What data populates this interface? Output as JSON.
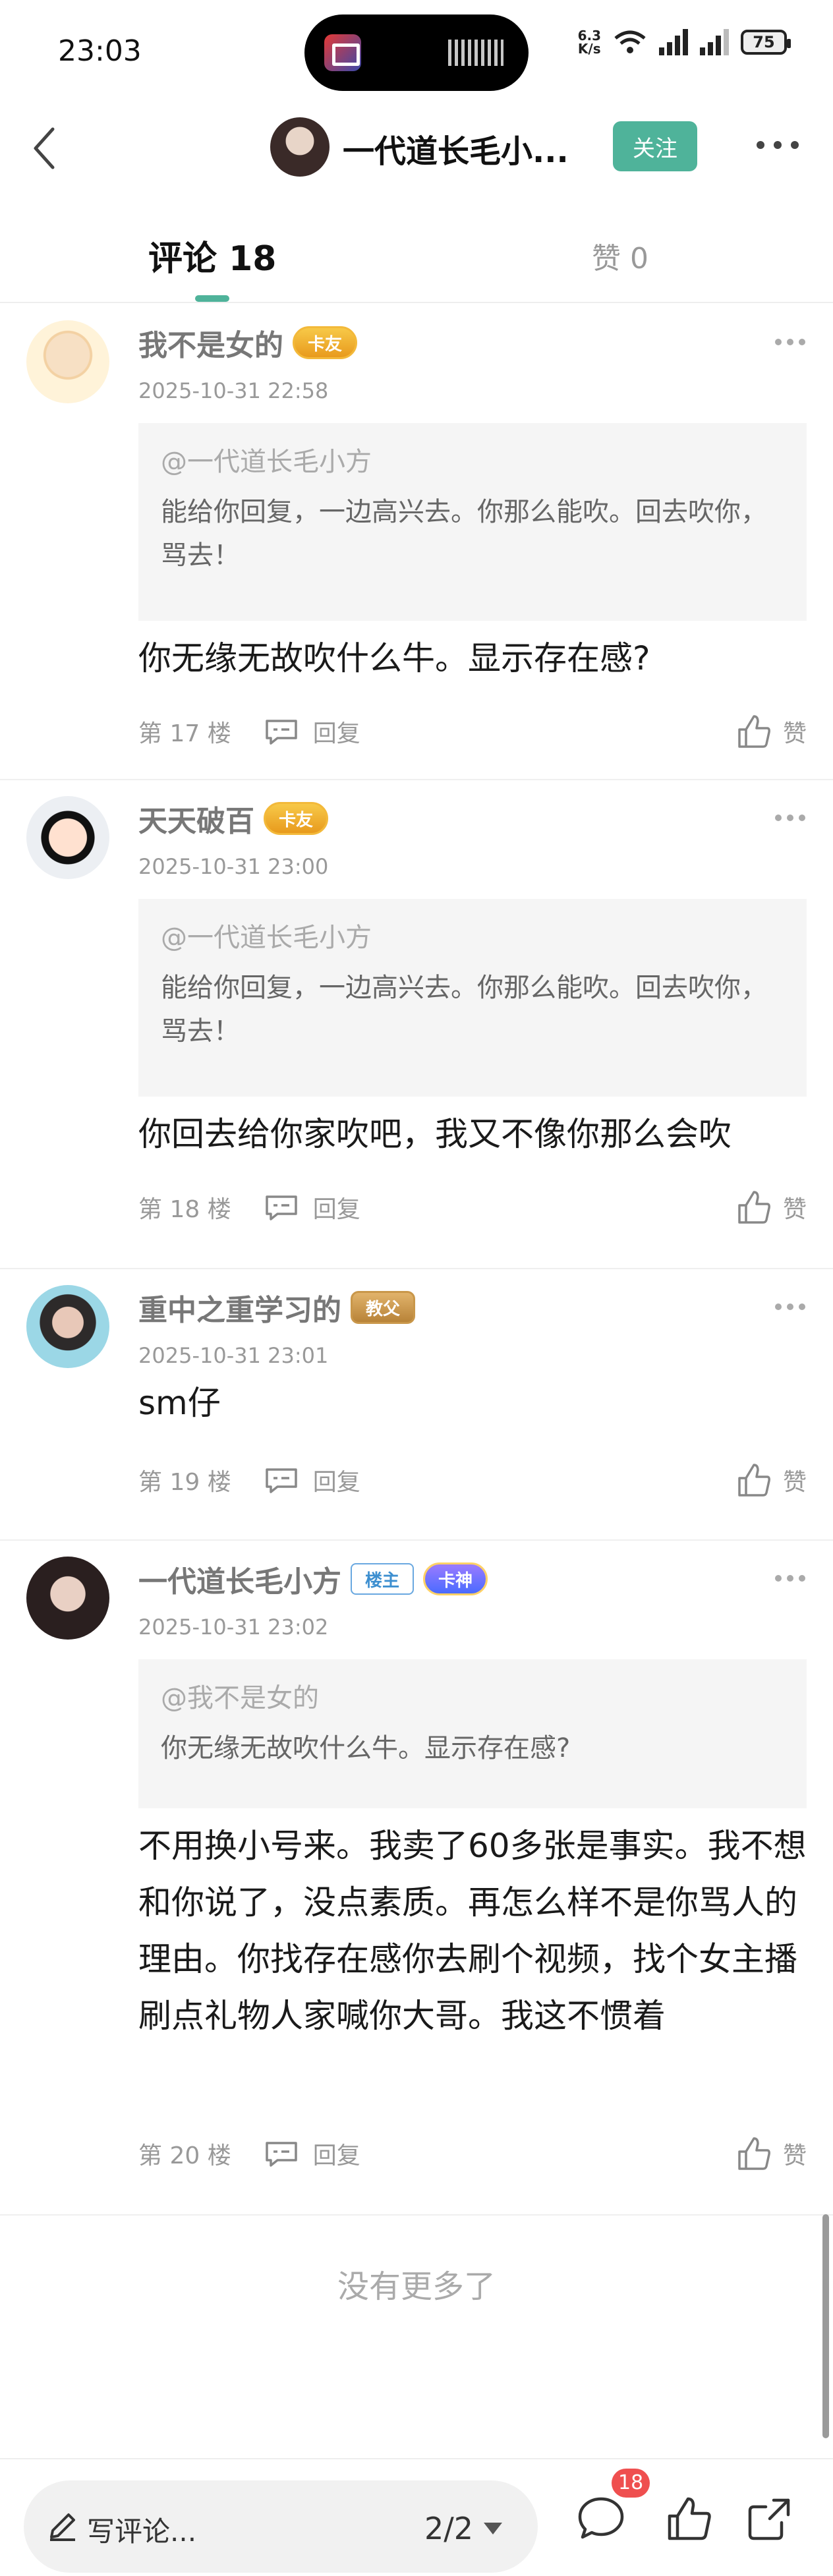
{
  "status_bar": {
    "time": "23:03",
    "net_speed_value": "6.3",
    "net_speed_unit": "K/s",
    "battery": "75"
  },
  "header": {
    "title": "一代道长毛小...",
    "follow_label": "关注"
  },
  "tabs": {
    "comments_label": "评论 18",
    "likes_label": "赞 0"
  },
  "comments": [
    {
      "username": "我不是女的",
      "badge": "卡友",
      "timestamp": "2025-10-31 22:58",
      "quote_user": "@一代道长毛小方",
      "quote_text": "能给你回复，一边高兴去。你那么能吹。回去吹你，骂去！",
      "text": "你无缘无故吹什么牛。显示存在感?",
      "floor": "第 17 楼",
      "reply_label": "回复",
      "like_label": "赞"
    },
    {
      "username": "天天破百",
      "badge": "卡友",
      "timestamp": "2025-10-31 23:00",
      "quote_user": "@一代道长毛小方",
      "quote_text": "能给你回复，一边高兴去。你那么能吹。回去吹你，骂去！",
      "text": "你回去给你家吹吧，我又不像你那么会吹",
      "floor": "第 18 楼",
      "reply_label": "回复",
      "like_label": "赞"
    },
    {
      "username": "重中之重学习的",
      "badge": "教父",
      "timestamp": "2025-10-31 23:01",
      "text": "sm仔",
      "floor": "第 19 楼",
      "reply_label": "回复",
      "like_label": "赞"
    },
    {
      "username": "一代道长毛小方",
      "badge_owner": "楼主",
      "badge": "卡神",
      "timestamp": "2025-10-31 23:02",
      "quote_user": "@我不是女的",
      "quote_text": "你无缘无故吹什么牛。显示存在感?",
      "text": "不用换小号来。我卖了60多张是事实。我不想和你说了，没点素质。再怎么样不是你骂人的理由。你找存在感你去刷个视频，找个女主播刷点礼物人家喊你大哥。我这不惯着",
      "floor": "第 20 楼",
      "reply_label": "回复",
      "like_label": "赞"
    }
  ],
  "footer_note": "没有更多了",
  "bottom_bar": {
    "write_placeholder": "写评论...",
    "page_indicator": "2/2",
    "comment_count": "18"
  }
}
